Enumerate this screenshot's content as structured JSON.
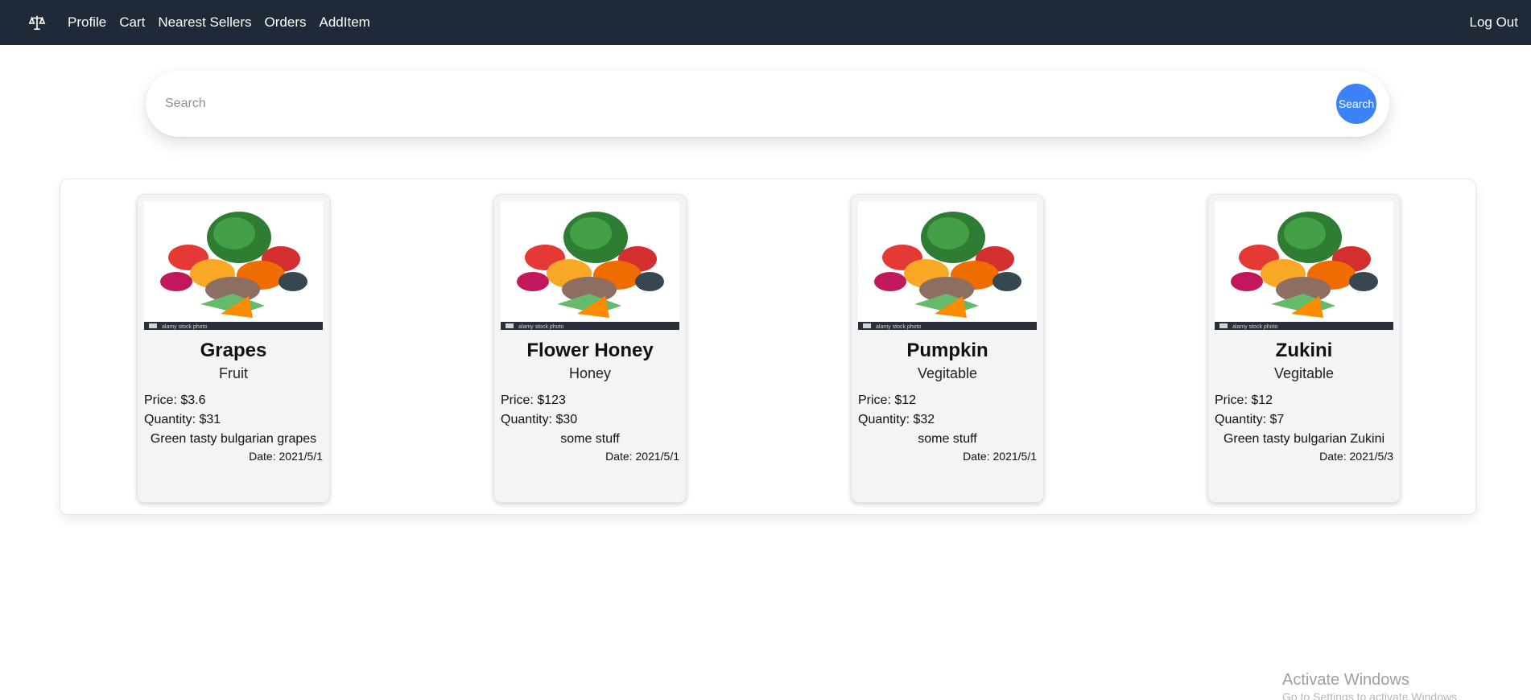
{
  "nav": {
    "logo_icon": "balance-scale-icon",
    "links": [
      "Profile",
      "Cart",
      "Nearest Sellers",
      "Orders",
      "AddItem"
    ],
    "logout": "Log Out"
  },
  "search": {
    "placeholder": "Search",
    "value": "",
    "button_label": "Search"
  },
  "products": [
    {
      "name": "Grapes",
      "category": "Fruit",
      "price": "Price: $3.6",
      "quantity": "Quantity: $31",
      "description": "Green tasty bulgarian grapes",
      "date": "Date: 2021/5/1",
      "image_caption": "alamy stock photo"
    },
    {
      "name": "Flower Honey",
      "category": "Honey",
      "price": "Price: $123",
      "quantity": "Quantity: $30",
      "description": "some stuff",
      "date": "Date: 2021/5/1",
      "image_caption": "alamy stock photo"
    },
    {
      "name": "Pumpkin",
      "category": "Vegitable",
      "price": "Price: $12",
      "quantity": "Quantity: $32",
      "description": "some stuff",
      "date": "Date: 2021/5/1",
      "image_caption": "alamy stock photo"
    },
    {
      "name": "Zukini",
      "category": "Vegitable",
      "price": "Price: $12",
      "quantity": "Quantity: $7",
      "description": "Green tasty bulgarian Zukini",
      "date": "Date: 2021/5/3",
      "image_caption": "alamy stock photo"
    }
  ],
  "watermark": {
    "title": "Activate Windows",
    "subtitle": "Go to Settings to activate Windows."
  },
  "colors": {
    "navbar": "#1f2937",
    "search_button": "#3b82f6",
    "card_bg": "#f3f4f6"
  }
}
